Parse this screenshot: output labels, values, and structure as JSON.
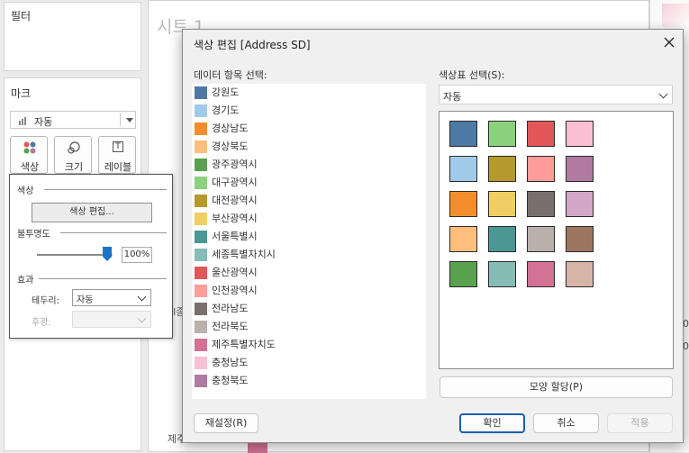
{
  "left_panel": {
    "filter_title": "필터",
    "marks_title": "마크",
    "mark_type": "자동",
    "buttons": [
      {
        "label": "색상",
        "icon": "color-dots-icon"
      },
      {
        "label": "크기",
        "icon": "size-icon"
      },
      {
        "label": "레이블",
        "icon": "label-icon"
      }
    ]
  },
  "sheet": {
    "title": "시트 1",
    "partial_left_text": "I종",
    "bottom_text": "제주",
    "right_axis_1": "0",
    "right_axis_2": "0"
  },
  "color_popup": {
    "section_color": "색상",
    "edit_colors_button": "색상 편집...",
    "opacity_label": "불투명도",
    "opacity_value": "100%",
    "opacity_fraction": 1.0,
    "effects_label": "효과",
    "border_label": "테두리:",
    "border_value": "자동",
    "halo_label": "후광:"
  },
  "dialog": {
    "title": "색상 편집 [Address SD]",
    "data_items_label": "데이터 항목 선택:",
    "palette_label": "색상표 선택(S):",
    "palette_value": "자동",
    "assign_button": "모양 할당(P)",
    "reset_button": "재설정(R)",
    "ok_button": "확인",
    "cancel_button": "취소",
    "apply_button": "적용",
    "items": [
      {
        "label": "강원도",
        "color": "#4e79a7"
      },
      {
        "label": "경기도",
        "color": "#a0cbe8"
      },
      {
        "label": "경상남도",
        "color": "#f28e2b"
      },
      {
        "label": "경상북도",
        "color": "#ffbe7d"
      },
      {
        "label": "광주광역시",
        "color": "#59a14f"
      },
      {
        "label": "대구광역시",
        "color": "#8cd17d"
      },
      {
        "label": "대전광역시",
        "color": "#b6992d"
      },
      {
        "label": "부산광역시",
        "color": "#f1ce63"
      },
      {
        "label": "서울특별시",
        "color": "#499894"
      },
      {
        "label": "세종특별자치시",
        "color": "#86bcb6"
      },
      {
        "label": "울산광역시",
        "color": "#e15759"
      },
      {
        "label": "인천광역시",
        "color": "#ff9d9a"
      },
      {
        "label": "전라남도",
        "color": "#79706e"
      },
      {
        "label": "전라북도",
        "color": "#bab0ac"
      },
      {
        "label": "제주특별자치도",
        "color": "#d37295"
      },
      {
        "label": "충청남도",
        "color": "#fabfd2"
      },
      {
        "label": "충청북도",
        "color": "#b07aa1"
      }
    ],
    "palette": [
      "#4e79a7",
      "#8cd17d",
      "#e15759",
      "#fabfd2",
      "#a0cbe8",
      "#b6992d",
      "#ff9d9a",
      "#b07aa1",
      "#f28e2b",
      "#f1ce63",
      "#79706e",
      "#d4a6c8",
      "#ffbe7d",
      "#499894",
      "#bab0ac",
      "#9d7660",
      "#59a14f",
      "#86bcb6",
      "#d37295",
      "#d7b5a6"
    ]
  }
}
